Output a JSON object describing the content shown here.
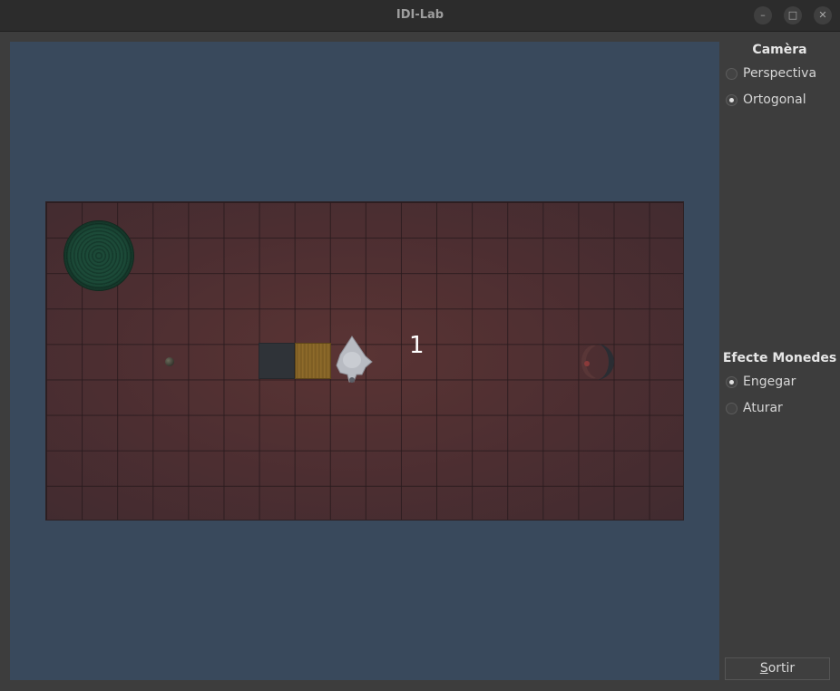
{
  "window": {
    "title": "IDI-Lab",
    "minimize_glyph": "–",
    "maximize_glyph": "□",
    "close_glyph": "✕"
  },
  "scene": {
    "score_text": "1",
    "colors": {
      "viewport_bg": "#39495c",
      "board": "#4c2e31",
      "hole": "#1c4a38"
    }
  },
  "camera": {
    "title": "Camèra",
    "options": [
      {
        "label": "Perspectiva",
        "selected": false
      },
      {
        "label": "Ortogonal",
        "selected": true
      }
    ]
  },
  "coin_effect": {
    "title": "Efecte Monedes",
    "options": [
      {
        "label": "Engegar",
        "selected": true
      },
      {
        "label": "Aturar",
        "selected": false
      }
    ]
  },
  "quit_button": {
    "mnemonic": "S",
    "rest": "ortir"
  }
}
